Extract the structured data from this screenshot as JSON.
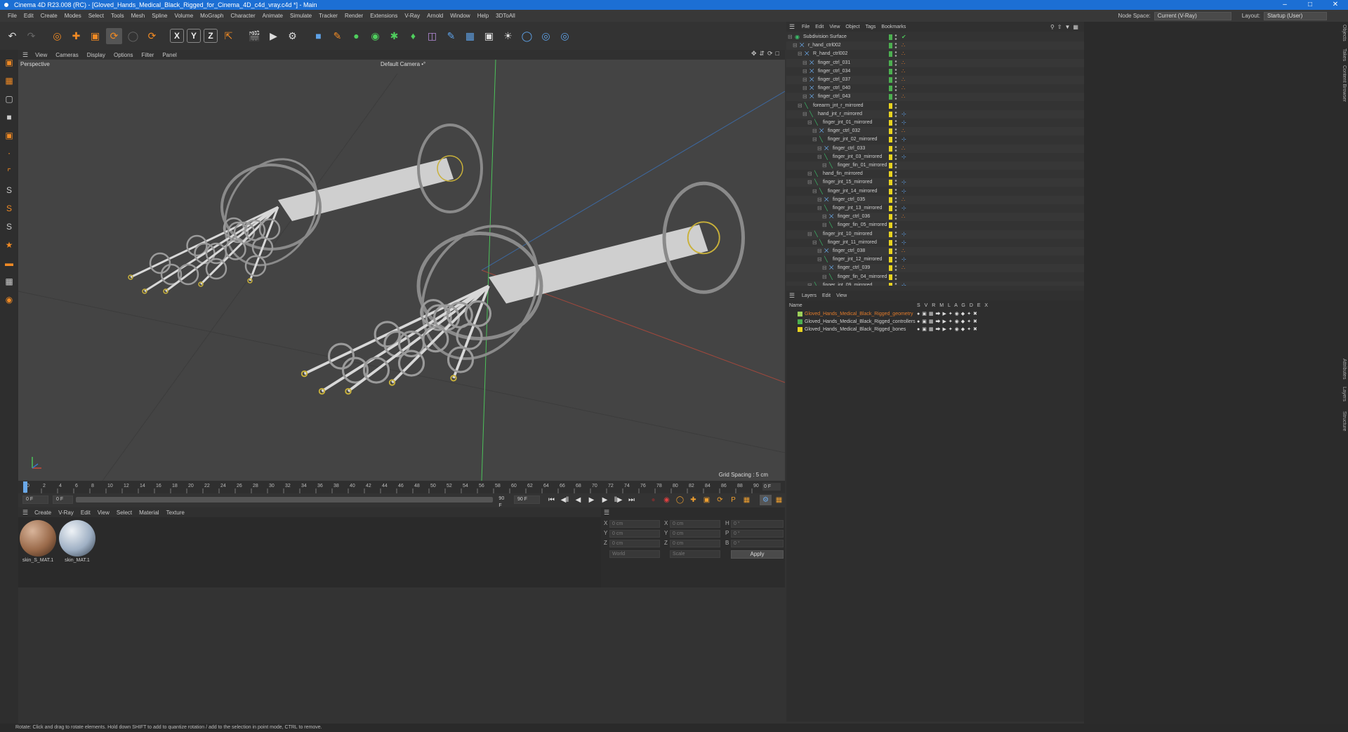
{
  "titlebar": {
    "title": "Cinema 4D R23.008 (RC) - [Gloved_Hands_Medical_Black_Rigged_for_Cinema_4D_c4d_vray.c4d *] - Main"
  },
  "menubar": {
    "items": [
      "File",
      "Edit",
      "Create",
      "Modes",
      "Select",
      "Tools",
      "Mesh",
      "Spline",
      "Volume",
      "MoGraph",
      "Character",
      "Animate",
      "Simulate",
      "Tracker",
      "Render",
      "Extensions",
      "V-Ray",
      "Arnold",
      "Window",
      "Help",
      "3DToAll"
    ],
    "node_space_label": "Node Space:",
    "node_space_value": "Current (V-Ray)",
    "layout_label": "Layout:",
    "layout_value": "Startup (User)"
  },
  "viewport": {
    "menu": [
      "View",
      "Cameras",
      "Display",
      "Options",
      "Filter",
      "Panel"
    ],
    "view_name": "Perspective",
    "camera_name": "Default Camera •°",
    "grid_spacing": "Grid Spacing : 5 cm",
    "axis_colors": {
      "x": "#c84a3a",
      "y": "#4cc25a",
      "z": "#3a78c8"
    }
  },
  "timeline": {
    "ticks": [
      "0",
      "2",
      "4",
      "6",
      "8",
      "10",
      "12",
      "14",
      "16",
      "18",
      "20",
      "22",
      "24",
      "26",
      "28",
      "30",
      "32",
      "34",
      "36",
      "38",
      "40",
      "42",
      "44",
      "46",
      "48",
      "50",
      "52",
      "54",
      "56",
      "58",
      "60",
      "62",
      "64",
      "66",
      "68",
      "70",
      "72",
      "74",
      "76",
      "78",
      "80",
      "82",
      "84",
      "86",
      "88",
      "90"
    ],
    "current_frame": "0 F"
  },
  "transport": {
    "start_frame": "0 F",
    "min_frame": "0 F",
    "max_frame": "90 F",
    "end_frame": "90 F"
  },
  "material_manager": {
    "menu": [
      "Create",
      "V-Ray",
      "Edit",
      "View",
      "Select",
      "Material",
      "Texture"
    ],
    "materials": [
      {
        "name": "skin_S_MAT.1",
        "color": "#9a6a4a"
      },
      {
        "name": "skin_MAT.1",
        "color": "#9fb0c4"
      }
    ]
  },
  "attributes": {
    "rows": [
      {
        "l1": "X",
        "v1": "0 cm",
        "l2": "X",
        "v2": "0 cm",
        "l3": "H",
        "v3": "0 °"
      },
      {
        "l1": "Y",
        "v1": "0 cm",
        "l2": "Y",
        "v2": "0 cm",
        "l3": "P",
        "v3": "0 °"
      },
      {
        "l1": "Z",
        "v1": "0 cm",
        "l2": "Z",
        "v2": "0 cm",
        "l3": "B",
        "v3": "0 °"
      }
    ],
    "coord_mode": "World",
    "size_mode": "Scale",
    "apply_label": "Apply"
  },
  "object_manager": {
    "menu": [
      "File",
      "Edit",
      "View",
      "Object",
      "Tags",
      "Bookmarks"
    ],
    "objects": [
      {
        "name": "Subdivision Surface",
        "indent": 0,
        "color": "#4caf50",
        "tag": "check",
        "icon": "subdiv"
      },
      {
        "name": "r_hand_ctrl002",
        "indent": 1,
        "color": "#4caf50",
        "tag": "orange",
        "icon": "null"
      },
      {
        "name": "R_hand_ctrl002",
        "indent": 2,
        "color": "#4caf50",
        "tag": "orange",
        "icon": "null"
      },
      {
        "name": "finger_ctrl_031",
        "indent": 3,
        "color": "#4caf50",
        "tag": "orange",
        "icon": "null"
      },
      {
        "name": "finger_ctrl_034",
        "indent": 3,
        "color": "#4caf50",
        "tag": "orange",
        "icon": "null"
      },
      {
        "name": "finger_ctrl_037",
        "indent": 3,
        "color": "#4caf50",
        "tag": "orange",
        "icon": "null"
      },
      {
        "name": "finger_ctrl_040",
        "indent": 3,
        "color": "#4caf50",
        "tag": "orange",
        "icon": "null"
      },
      {
        "name": "finger_ctrl_043",
        "indent": 3,
        "color": "#4caf50",
        "tag": "orange",
        "icon": "null"
      },
      {
        "name": "forearm_jnt_r_mirrored",
        "indent": 2,
        "color": "#e8d21f",
        "tag": "",
        "icon": "joint"
      },
      {
        "name": "hand_jnt_r_mirrored",
        "indent": 3,
        "color": "#e8d21f",
        "tag": "blue",
        "icon": "joint"
      },
      {
        "name": "finger_jnt_01_mirrored",
        "indent": 4,
        "color": "#e8d21f",
        "tag": "blue",
        "icon": "joint"
      },
      {
        "name": "finger_ctrl_032",
        "indent": 5,
        "color": "#e8d21f",
        "tag": "orange",
        "icon": "null"
      },
      {
        "name": "finger_jnt_02_mirrored",
        "indent": 5,
        "color": "#e8d21f",
        "tag": "blue",
        "icon": "joint"
      },
      {
        "name": "finger_ctrl_033",
        "indent": 6,
        "color": "#e8d21f",
        "tag": "orange",
        "icon": "null"
      },
      {
        "name": "finger_jnt_03_mirrored",
        "indent": 6,
        "color": "#e8d21f",
        "tag": "blue",
        "icon": "joint"
      },
      {
        "name": "finger_fin_01_mirrored",
        "indent": 7,
        "color": "#e8d21f",
        "tag": "",
        "icon": "joint"
      },
      {
        "name": "hand_fin_mirrored",
        "indent": 4,
        "color": "#e8d21f",
        "tag": "",
        "icon": "joint"
      },
      {
        "name": "finger_jnt_15_mirrored",
        "indent": 4,
        "color": "#e8d21f",
        "tag": "blue",
        "icon": "joint"
      },
      {
        "name": "finger_jnt_14_mirrored",
        "indent": 5,
        "color": "#e8d21f",
        "tag": "blue",
        "icon": "joint"
      },
      {
        "name": "finger_ctrl_035",
        "indent": 6,
        "color": "#e8d21f",
        "tag": "orange",
        "icon": "null"
      },
      {
        "name": "finger_jnt_13_mirrored",
        "indent": 6,
        "color": "#e8d21f",
        "tag": "blue",
        "icon": "joint"
      },
      {
        "name": "finger_ctrl_036",
        "indent": 7,
        "color": "#e8d21f",
        "tag": "orange",
        "icon": "null"
      },
      {
        "name": "finger_fin_05_mirrored",
        "indent": 7,
        "color": "#e8d21f",
        "tag": "",
        "icon": "joint"
      },
      {
        "name": "finger_jnt_10_mirrored",
        "indent": 4,
        "color": "#e8d21f",
        "tag": "blue",
        "icon": "joint"
      },
      {
        "name": "finger_jnt_11_mirrored",
        "indent": 5,
        "color": "#e8d21f",
        "tag": "blue",
        "icon": "joint"
      },
      {
        "name": "finger_ctrl_038",
        "indent": 6,
        "color": "#e8d21f",
        "tag": "orange",
        "icon": "null"
      },
      {
        "name": "finger_jnt_12_mirrored",
        "indent": 6,
        "color": "#e8d21f",
        "tag": "blue",
        "icon": "joint"
      },
      {
        "name": "finger_ctrl_039",
        "indent": 7,
        "color": "#e8d21f",
        "tag": "orange",
        "icon": "null"
      },
      {
        "name": "finger_fin_04_mirrored",
        "indent": 7,
        "color": "#e8d21f",
        "tag": "",
        "icon": "joint"
      },
      {
        "name": "finger_jnt_09_mirrored",
        "indent": 4,
        "color": "#e8d21f",
        "tag": "blue",
        "icon": "joint"
      }
    ]
  },
  "layers_manager": {
    "menu": [
      "Layers",
      "Edit",
      "View"
    ],
    "name_header": "Name",
    "flag_headers": "S V R M L A G D E X",
    "layers": [
      {
        "name": "Gloved_Hands_Medical_Black_Rigged_geometry",
        "color": "#9ccf5a",
        "text_color": "#e07a2a"
      },
      {
        "name": "Gloved_Hands_Medical_Black_Rigged_controllers",
        "color": "#4caf50",
        "text_color": "#cfcfcf"
      },
      {
        "name": "Gloved_Hands_Medical_Black_Rigged_bones",
        "color": "#e8d21f",
        "text_color": "#cfcfcf"
      }
    ]
  },
  "right_tabs": [
    "Objects",
    "Takes",
    "Content Browser",
    "Layers",
    "Attributes",
    "Structure"
  ],
  "statusbar": {
    "text": "Rotate: Click and drag to rotate elements. Hold down SHIFT to add to quantize rotation / add to the selection in point mode, CTRL to remove."
  }
}
